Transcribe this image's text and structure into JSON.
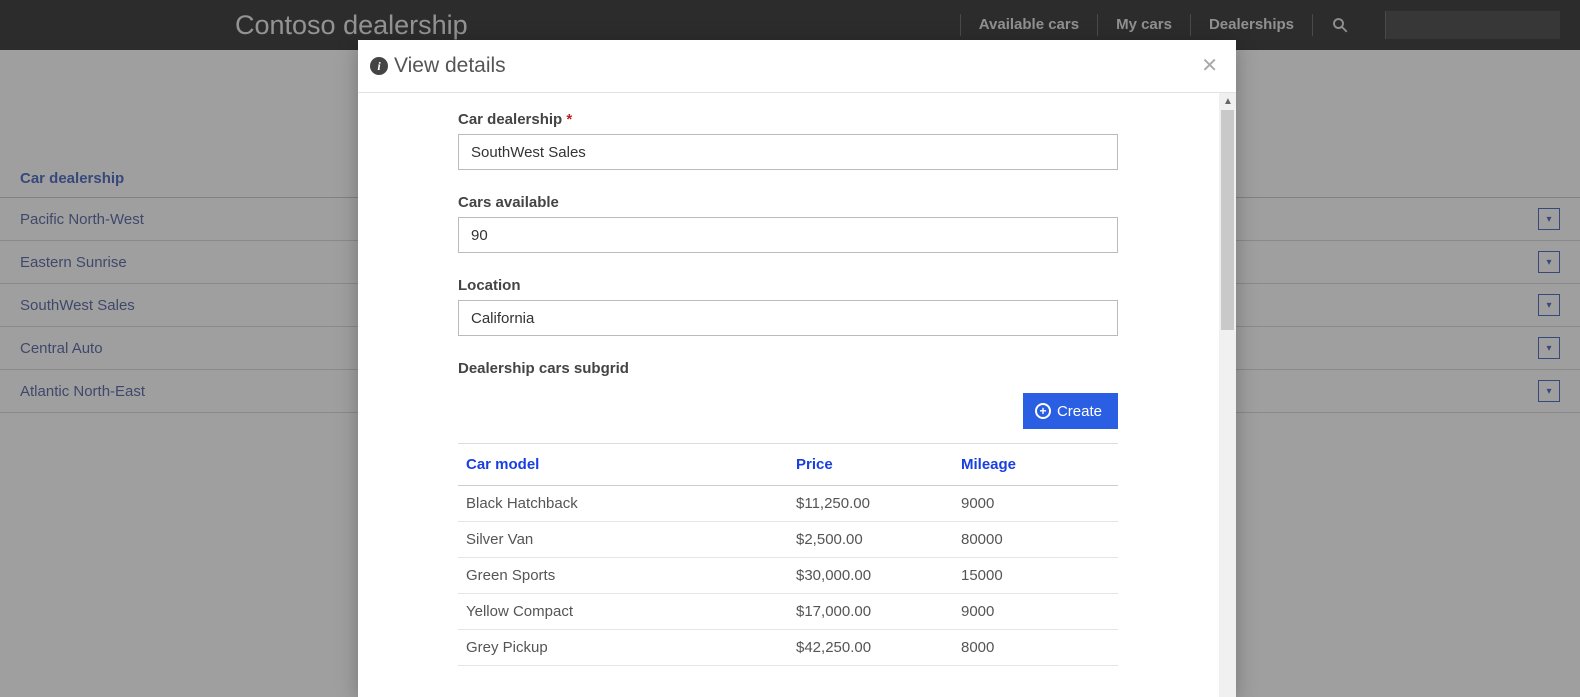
{
  "header": {
    "brand": "Contoso dealership",
    "nav": {
      "available_cars": "Available cars",
      "my_cars": "My cars",
      "dealerships": "Dealerships"
    }
  },
  "background_list": {
    "column_header": "Car dealership",
    "rows": [
      {
        "name": "Pacific North-West"
      },
      {
        "name": "Eastern Sunrise"
      },
      {
        "name": "SouthWest Sales"
      },
      {
        "name": "Central Auto"
      },
      {
        "name": "Atlantic North-East"
      }
    ]
  },
  "modal": {
    "title": "View details",
    "fields": {
      "dealership": {
        "label": "Car dealership",
        "required_mark": "*",
        "value": "SouthWest Sales"
      },
      "cars_available": {
        "label": "Cars available",
        "value": "90"
      },
      "location": {
        "label": "Location",
        "value": "California"
      },
      "subgrid_label": "Dealership cars subgrid",
      "create_label": "Create"
    },
    "subgrid": {
      "columns": {
        "model": "Car model",
        "price": "Price",
        "mileage": "Mileage"
      },
      "rows": [
        {
          "model": "Black Hatchback",
          "price": "$11,250.00",
          "mileage": "9000"
        },
        {
          "model": "Silver Van",
          "price": "$2,500.00",
          "mileage": "80000"
        },
        {
          "model": "Green Sports",
          "price": "$30,000.00",
          "mileage": "15000"
        },
        {
          "model": "Yellow Compact",
          "price": "$17,000.00",
          "mileage": "9000"
        },
        {
          "model": "Grey Pickup",
          "price": "$42,250.00",
          "mileage": "8000"
        }
      ]
    }
  }
}
